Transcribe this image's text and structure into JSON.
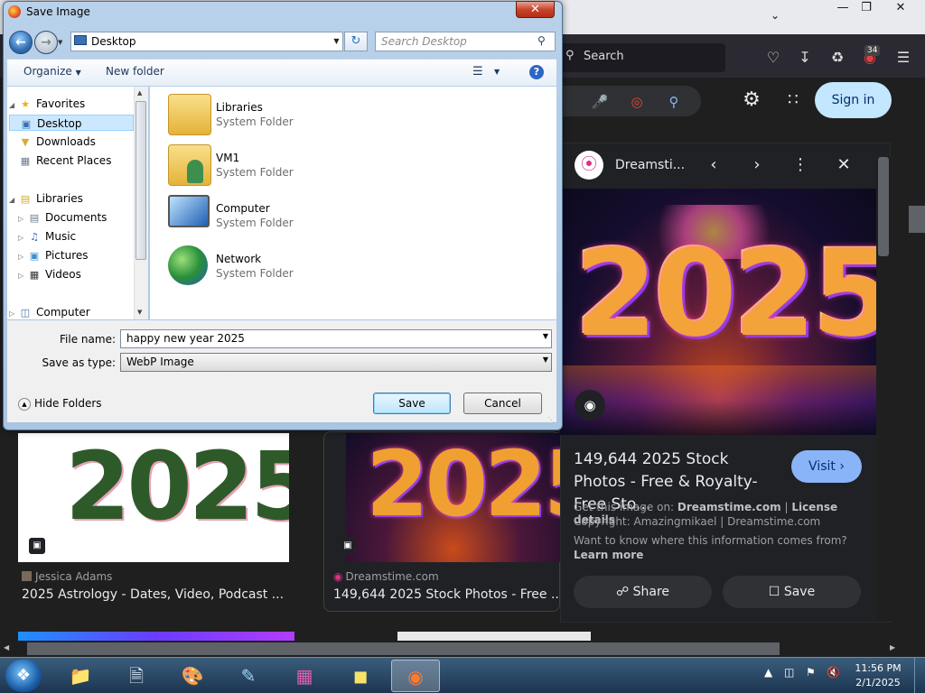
{
  "browser": {
    "search_placeholder": "Search",
    "downloads_badge": "34",
    "google": {
      "signin": "Sign in"
    }
  },
  "panel": {
    "source_name": "Dreamsti...",
    "image_text": "2025",
    "title": "149,644 2025 Stock Photos - Free & Royalty-Free Sto...",
    "visit": "Visit",
    "get_image_prefix": "Get this image on:",
    "get_image_site": "Dreamstime.com",
    "separator": "|",
    "license": "License details",
    "copyright": "Copyright: Amazingmikael | Dreamstime.com",
    "info_question": "Want to know where this information comes from?",
    "learn_more": "Learn more",
    "share": "Share",
    "save": "Save"
  },
  "results": [
    {
      "image_text": "2025",
      "source": "Jessica Adams",
      "title": "2025 Astrology - Dates, Video, Podcast ..."
    },
    {
      "image_text": "2025",
      "source": "Dreamstime.com",
      "title": "149,644 2025 Stock Photos - Free ..."
    }
  ],
  "dialog": {
    "title": "Save Image",
    "address": "Desktop",
    "search_placeholder": "Search Desktop",
    "organize": "Organize",
    "new_folder": "New folder",
    "help": "?",
    "nav": {
      "favorites": "Favorites",
      "desktop": "Desktop",
      "downloads": "Downloads",
      "recent_places": "Recent Places",
      "libraries": "Libraries",
      "documents": "Documents",
      "music": "Music",
      "pictures": "Pictures",
      "videos": "Videos",
      "computer": "Computer"
    },
    "items": [
      {
        "name": "Libraries",
        "type": "System Folder"
      },
      {
        "name": "VM1",
        "type": "System Folder"
      },
      {
        "name": "Computer",
        "type": "System Folder"
      },
      {
        "name": "Network",
        "type": "System Folder"
      }
    ],
    "file_name_label": "File name:",
    "file_name_value": "happy new year 2025",
    "save_type_label": "Save as type:",
    "save_type_value": "WebP Image",
    "hide_folders": "Hide Folders",
    "save_button": "Save",
    "cancel_button": "Cancel"
  },
  "taskbar": {
    "time": "11:56 PM",
    "date": "2/1/2025"
  }
}
